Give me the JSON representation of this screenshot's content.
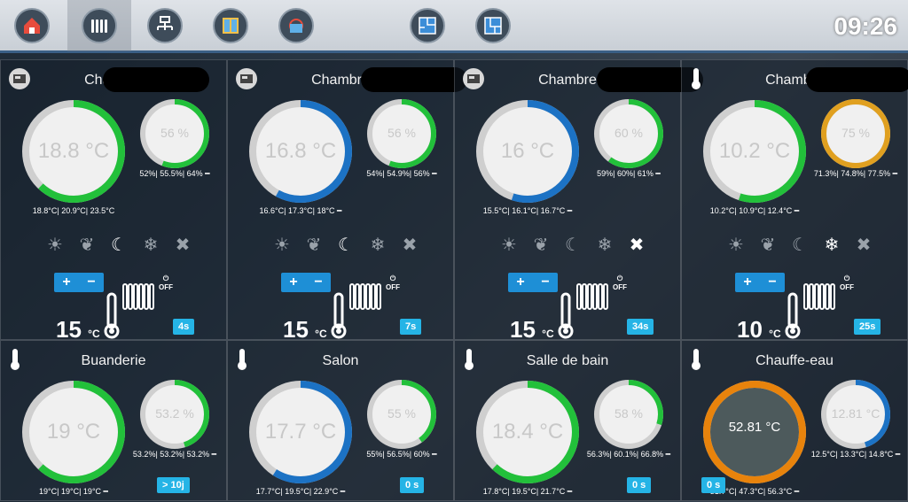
{
  "clock": "09:26",
  "nav": [
    "home-icon",
    "radiator-icon",
    "network-icon",
    "window-icon",
    "refresh-icon",
    "floorplan-icon",
    "floorplan-2-icon"
  ],
  "panels": [
    {
      "title": "Chambre",
      "temp": "18.8 °C",
      "humid": "56 %",
      "tstats": "18.8°C| 20.9°C| 23.5°C",
      "hstats": "52%| 55.5%| 64% ━",
      "setpoint": "15",
      "unit": "°C",
      "timer": "4s",
      "tcolor": "#22c03a",
      "tfrac": 0.62,
      "hcolor": "#22c03a",
      "hfrac": 0.56,
      "icon": "thermostat-icon",
      "activeMode": "night"
    },
    {
      "title": "Chambre",
      "temp": "16.8 °C",
      "humid": "56 %",
      "tstats": "16.6°C| 17.3°C| 18°C ━",
      "hstats": "54%| 54.9%| 56% ━",
      "setpoint": "15",
      "unit": "°C",
      "timer": "7s",
      "tcolor": "#1c72c4",
      "tfrac": 0.58,
      "hcolor": "#22c03a",
      "hfrac": 0.56,
      "icon": "thermostat-icon",
      "activeMode": "night"
    },
    {
      "title": "Chambre",
      "temp": "16 °C",
      "humid": "60 %",
      "tstats": "15.5°C| 16.1°C| 16.7°C ━",
      "hstats": "59%| 60%| 61% ━",
      "setpoint": "15",
      "unit": "°C",
      "timer": "34s",
      "tcolor": "#1c72c4",
      "tfrac": 0.55,
      "hcolor": "#22c03a",
      "hfrac": 0.6,
      "icon": "thermostat-icon",
      "activeMode": "off"
    },
    {
      "title": "Chambre",
      "temp": "10.2 °C",
      "humid": "75 %",
      "tstats": "10.2°C| 10.9°C| 12.4°C ━",
      "hstats": "71.3%| 74.8%| 77.5% ━",
      "setpoint": "10",
      "unit": "°C",
      "timer": "25s",
      "tcolor": "#22c03a",
      "tfrac": 0.55,
      "hcolor": "#e0a020",
      "hfrac": 1.0,
      "icon": "thermometer-icon",
      "activeMode": "frost"
    },
    {
      "title": "Buanderie",
      "temp": "19 °C",
      "humid": "53.2 %",
      "tstats": "19°C| 19°C| 19°C ━",
      "hstats": "53.2%| 53.2%| 53.2% ━",
      "timer": "> 10j",
      "tcolor": "#22c03a",
      "tfrac": 0.62,
      "hcolor": "#22c03a",
      "hfrac": 0.45
    },
    {
      "title": "Salon",
      "temp": "17.7 °C",
      "humid": "55 %",
      "tstats": "17.7°C| 19.5°C| 22.9°C ━",
      "hstats": "55%| 56.5%| 60% ━",
      "timer": "0 s",
      "tcolor": "#1c72c4",
      "tfrac": 0.59,
      "hcolor": "#22c03a",
      "hfrac": 0.4
    },
    {
      "title": "Salle de bain",
      "temp": "18.4 °C",
      "humid": "58 %",
      "tstats": "17.8°C| 19.5°C| 21.7°C ━",
      "hstats": "56.3%| 60.1%| 66.8% ━",
      "timer": "0 s",
      "tcolor": "#22c03a",
      "tfrac": 0.62,
      "hcolor": "#22c03a",
      "hfrac": 0.3
    },
    {
      "title": "Chauffe-eau",
      "temp": "52.81 °C",
      "humid": "12.81 °C",
      "tstats": "31.7°C| 47.3°C| 56.3°C ━",
      "hstats": "12.5°C| 13.3°C| 14.8°C ━",
      "timer": "0 s",
      "tcolor": "#e8830c",
      "tfrac": 1.0,
      "hcolor": "#1c72c4",
      "hfrac": 0.45
    }
  ],
  "modes": [
    "sun",
    "leaf",
    "night",
    "frost",
    "off"
  ],
  "pm": {
    "plus": "+",
    "minus": "−",
    "off": "OFF"
  }
}
